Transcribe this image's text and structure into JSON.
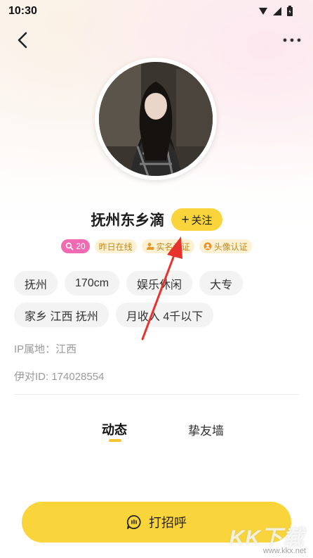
{
  "status_bar": {
    "time": "10:30"
  },
  "profile": {
    "name": "抚州东乡滴",
    "follow_label": "关注",
    "badges": [
      {
        "text": "20",
        "icon": "search-icon"
      },
      {
        "text": "昨日在线"
      },
      {
        "text": "实名认证",
        "icon": "user-verified-icon"
      },
      {
        "text": "头像认证",
        "icon": "avatar-verified-icon"
      }
    ],
    "tags_row1": [
      "抚州",
      "170cm",
      "娱乐休闲",
      "大专"
    ],
    "tags_row2": [
      "家乡 江西 抚州",
      "月收入 4千以下"
    ],
    "ip_location": "IP属地：江西",
    "user_id": "伊对ID: 174028554"
  },
  "tabs": [
    {
      "label": "动态",
      "active": true
    },
    {
      "label": "挚友墙",
      "active": false
    }
  ],
  "greet_button": {
    "label": "打招呼"
  },
  "watermark": {
    "main": "KK下载",
    "url": "www.kkx.net"
  },
  "colors": {
    "accent": "#f9d53b",
    "pink_badge": "#f16ab2",
    "annotation_arrow": "#e8322c"
  }
}
